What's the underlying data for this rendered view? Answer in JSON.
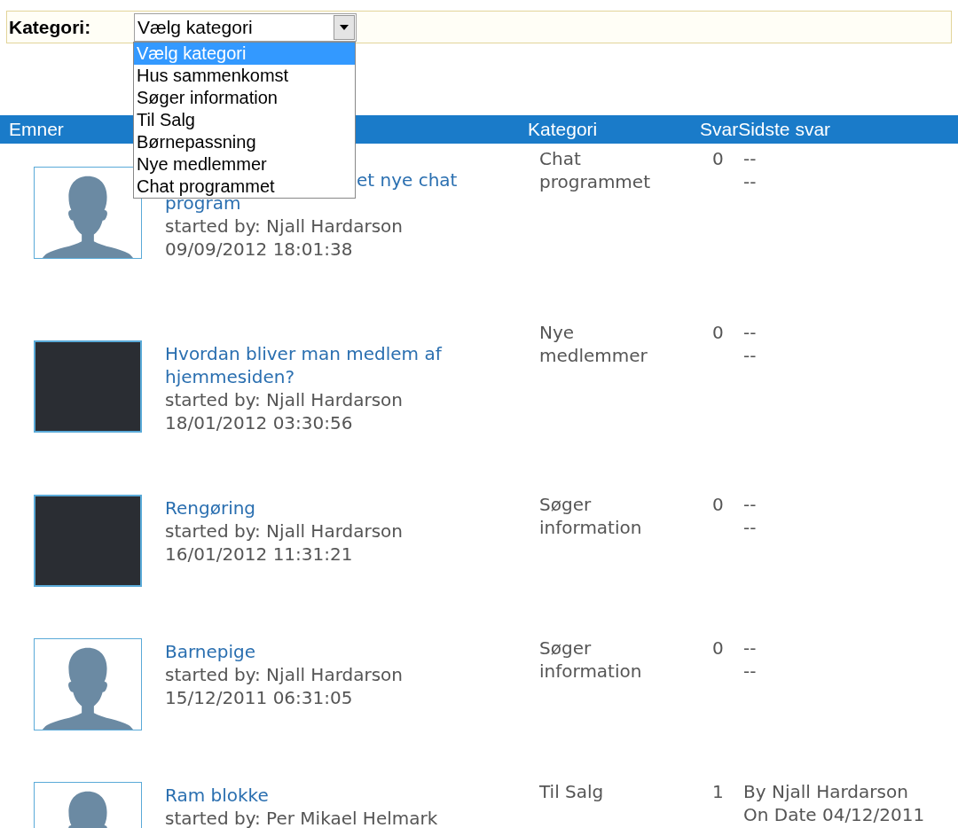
{
  "filter": {
    "label": "Kategori:",
    "value": "Vælg kategori",
    "options": [
      {
        "label": "Vælg kategori",
        "selected": true
      },
      {
        "label": "Hus sammenkomst",
        "selected": false
      },
      {
        "label": "Søger information",
        "selected": false
      },
      {
        "label": "Til Salg",
        "selected": false
      },
      {
        "label": "Børnepassning",
        "selected": false
      },
      {
        "label": "Nye medlemmer",
        "selected": false
      },
      {
        "label": "Chat programmet",
        "selected": false
      }
    ]
  },
  "table": {
    "columns": [
      "Emner",
      "Kategori",
      "Svar",
      "Sidste svar"
    ],
    "rows": [
      {
        "kind": "silhouette",
        "title_lines": [
          "et nye chat",
          "program"
        ],
        "started_by": "started by: Njall Hardarson",
        "date": "09/09/2012 18:01:38",
        "category": "Chat programmet",
        "replies": "0",
        "last_reply": [
          "--",
          "--"
        ]
      },
      {
        "kind": "photo",
        "title_lines": [
          "Hvordan bliver man medlem af",
          "hjemmesiden?"
        ],
        "started_by": "started by: Njall Hardarson",
        "date": "18/01/2012 03:30:56",
        "category": "Nye medlemmer",
        "replies": "0",
        "last_reply": [
          "--",
          "--"
        ]
      },
      {
        "kind": "photo",
        "title_lines": [
          "Rengøring"
        ],
        "started_by": "started by: Njall Hardarson",
        "date": "16/01/2012 11:31:21",
        "category": "Søger information",
        "replies": "0",
        "last_reply": [
          "--",
          "--"
        ]
      },
      {
        "kind": "silhouette",
        "title_lines": [
          "Barnepige"
        ],
        "started_by": "started by: Njall Hardarson",
        "date": "15/12/2011 06:31:05",
        "category": "Søger information",
        "replies": "0",
        "last_reply": [
          "--",
          "--"
        ]
      },
      {
        "kind": "silhouette",
        "title_lines": [
          "Ram blokke"
        ],
        "started_by": "started by: Per Mikael Helmark",
        "category": "Til Salg",
        "replies": "1",
        "last_reply": [
          "By Njall Hardarson",
          "On Date 04/12/2011"
        ]
      }
    ]
  }
}
